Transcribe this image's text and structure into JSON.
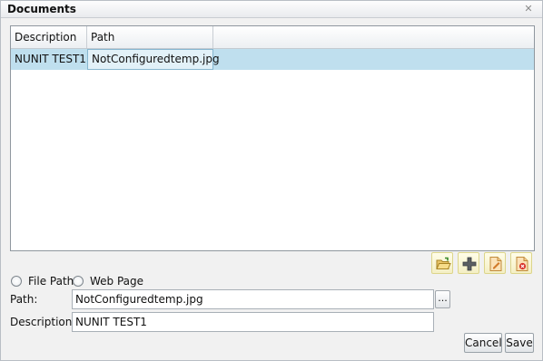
{
  "dialog": {
    "title": "Documents",
    "close_icon": "close-icon"
  },
  "grid": {
    "columns": [
      "Description",
      "Path"
    ],
    "rows": [
      {
        "description": "NUNIT TEST1",
        "path": "NotConfiguredtemp.jpg"
      }
    ]
  },
  "toolbar": {
    "buttons": [
      "open-folder-icon",
      "add-icon",
      "edit-document-icon",
      "delete-document-icon"
    ]
  },
  "source_type": {
    "options": [
      "File Path",
      "Web Page"
    ],
    "selected": "none"
  },
  "form": {
    "path_label": "Path:",
    "path_value": "NotConfiguredtemp.jpg",
    "browse_label": "...",
    "description_label": "Description:",
    "description_value": "NUNIT TEST1"
  },
  "actions": {
    "cancel_label": "Cancel",
    "save_label": "Save"
  },
  "colors": {
    "selected_row": "#bfdfee",
    "toolbar_button": "#f4efc4"
  }
}
